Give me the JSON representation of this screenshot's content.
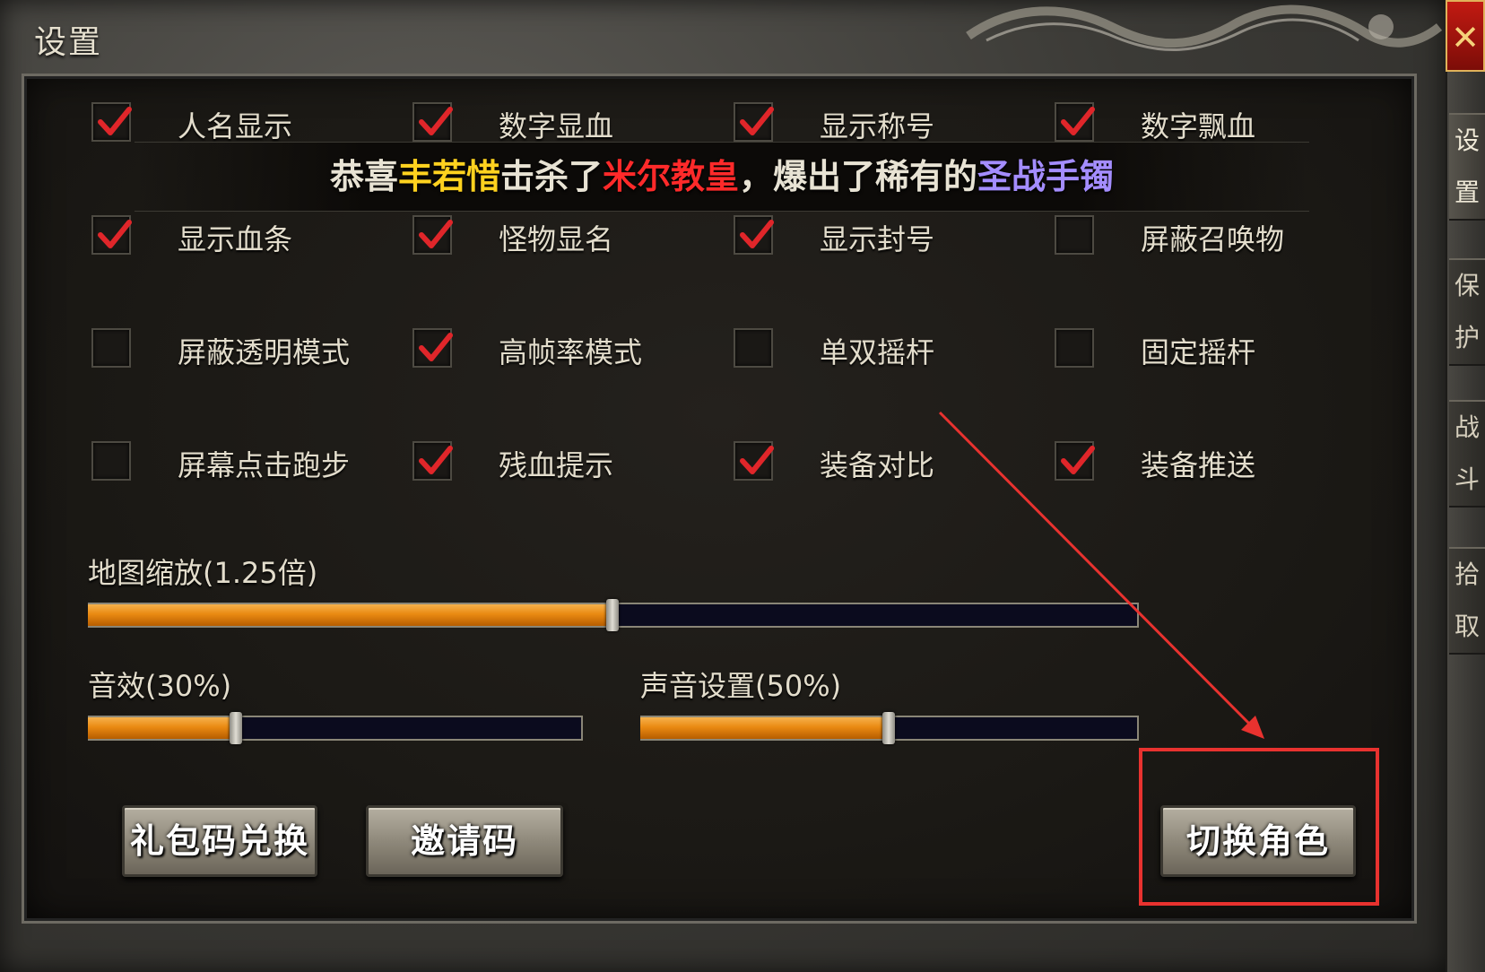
{
  "window": {
    "title": "设置",
    "close_label": "✕"
  },
  "side_tabs": [
    {
      "label": "设\n置",
      "active": true
    },
    {
      "label": "保\n护",
      "active": false
    },
    {
      "label": "战\n斗",
      "active": false
    },
    {
      "label": "拾\n取",
      "active": false
    }
  ],
  "options_row1": [
    {
      "label": "人名显示",
      "checked": true
    },
    {
      "label": "数字显血",
      "checked": true
    },
    {
      "label": "显示称号",
      "checked": true
    },
    {
      "label": "数字飘血",
      "checked": true
    }
  ],
  "banner": {
    "p1": "恭喜",
    "player": "丰若惜",
    "p2": "击杀了",
    "boss": "米尔教皇",
    "p3": "，爆出了稀有的",
    "item": "圣战手镯",
    "colors": {
      "text": "#e8e3d4",
      "player": "#ffd21f",
      "boss": "#ff2a2a",
      "item": "#a48dff"
    }
  },
  "options_row2": [
    {
      "label": "显示血条",
      "checked": true
    },
    {
      "label": "怪物显名",
      "checked": true
    },
    {
      "label": "显示封号",
      "checked": true
    },
    {
      "label": "屏蔽召唤物",
      "checked": false
    }
  ],
  "options_row3": [
    {
      "label": "屏蔽透明模式",
      "checked": false
    },
    {
      "label": "高帧率模式",
      "checked": true
    },
    {
      "label": "单双摇杆",
      "checked": false
    },
    {
      "label": "固定摇杆",
      "checked": false
    }
  ],
  "options_row4": [
    {
      "label": "屏幕点击跑步",
      "checked": false
    },
    {
      "label": "残血提示",
      "checked": true
    },
    {
      "label": "装备对比",
      "checked": true
    },
    {
      "label": "装备推送",
      "checked": true
    }
  ],
  "sliders": {
    "map_zoom": {
      "label": "地图缩放(1.25倍)",
      "value": 0.5
    },
    "sound_effect": {
      "label": "音效(30%)",
      "value": 0.3
    },
    "sound_setting": {
      "label": "声音设置(50%)",
      "value": 0.5
    }
  },
  "buttons": {
    "gift_code": "礼包码兑换",
    "invite_code": "邀请码",
    "switch_role": "切换角色"
  },
  "colors": {
    "check": "#e0262a",
    "fill": "#ea8a12",
    "annotation": "#e8322f"
  }
}
